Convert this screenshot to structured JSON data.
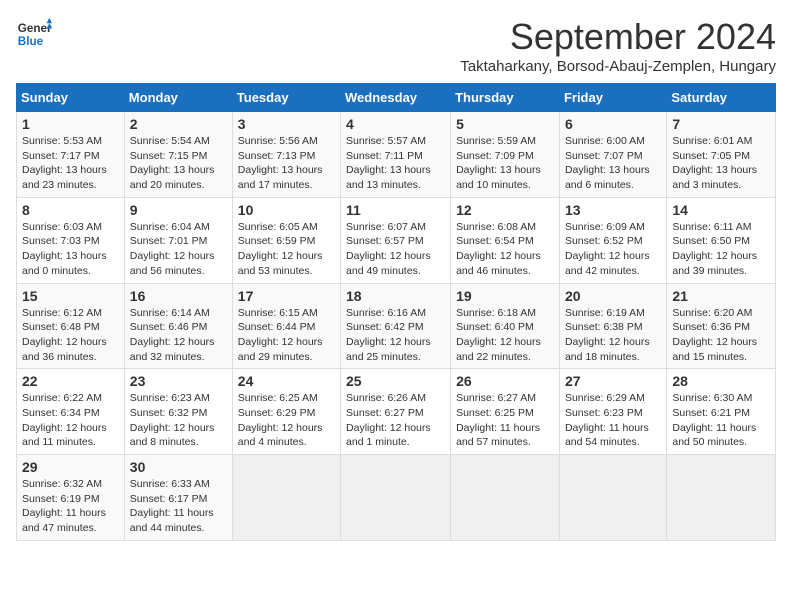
{
  "header": {
    "logo_general": "General",
    "logo_blue": "Blue",
    "month_title": "September 2024",
    "subtitle": "Taktaharkany, Borsod-Abauj-Zemplen, Hungary"
  },
  "days_of_week": [
    "Sunday",
    "Monday",
    "Tuesday",
    "Wednesday",
    "Thursday",
    "Friday",
    "Saturday"
  ],
  "weeks": [
    [
      {
        "day": "1",
        "sunrise": "5:53 AM",
        "sunset": "7:17 PM",
        "daylight": "13 hours and 23 minutes."
      },
      {
        "day": "2",
        "sunrise": "5:54 AM",
        "sunset": "7:15 PM",
        "daylight": "13 hours and 20 minutes."
      },
      {
        "day": "3",
        "sunrise": "5:56 AM",
        "sunset": "7:13 PM",
        "daylight": "13 hours and 17 minutes."
      },
      {
        "day": "4",
        "sunrise": "5:57 AM",
        "sunset": "7:11 PM",
        "daylight": "13 hours and 13 minutes."
      },
      {
        "day": "5",
        "sunrise": "5:59 AM",
        "sunset": "7:09 PM",
        "daylight": "13 hours and 10 minutes."
      },
      {
        "day": "6",
        "sunrise": "6:00 AM",
        "sunset": "7:07 PM",
        "daylight": "13 hours and 6 minutes."
      },
      {
        "day": "7",
        "sunrise": "6:01 AM",
        "sunset": "7:05 PM",
        "daylight": "13 hours and 3 minutes."
      }
    ],
    [
      {
        "day": "8",
        "sunrise": "6:03 AM",
        "sunset": "7:03 PM",
        "daylight": "13 hours and 0 minutes."
      },
      {
        "day": "9",
        "sunrise": "6:04 AM",
        "sunset": "7:01 PM",
        "daylight": "12 hours and 56 minutes."
      },
      {
        "day": "10",
        "sunrise": "6:05 AM",
        "sunset": "6:59 PM",
        "daylight": "12 hours and 53 minutes."
      },
      {
        "day": "11",
        "sunrise": "6:07 AM",
        "sunset": "6:57 PM",
        "daylight": "12 hours and 49 minutes."
      },
      {
        "day": "12",
        "sunrise": "6:08 AM",
        "sunset": "6:54 PM",
        "daylight": "12 hours and 46 minutes."
      },
      {
        "day": "13",
        "sunrise": "6:09 AM",
        "sunset": "6:52 PM",
        "daylight": "12 hours and 42 minutes."
      },
      {
        "day": "14",
        "sunrise": "6:11 AM",
        "sunset": "6:50 PM",
        "daylight": "12 hours and 39 minutes."
      }
    ],
    [
      {
        "day": "15",
        "sunrise": "6:12 AM",
        "sunset": "6:48 PM",
        "daylight": "12 hours and 36 minutes."
      },
      {
        "day": "16",
        "sunrise": "6:14 AM",
        "sunset": "6:46 PM",
        "daylight": "12 hours and 32 minutes."
      },
      {
        "day": "17",
        "sunrise": "6:15 AM",
        "sunset": "6:44 PM",
        "daylight": "12 hours and 29 minutes."
      },
      {
        "day": "18",
        "sunrise": "6:16 AM",
        "sunset": "6:42 PM",
        "daylight": "12 hours and 25 minutes."
      },
      {
        "day": "19",
        "sunrise": "6:18 AM",
        "sunset": "6:40 PM",
        "daylight": "12 hours and 22 minutes."
      },
      {
        "day": "20",
        "sunrise": "6:19 AM",
        "sunset": "6:38 PM",
        "daylight": "12 hours and 18 minutes."
      },
      {
        "day": "21",
        "sunrise": "6:20 AM",
        "sunset": "6:36 PM",
        "daylight": "12 hours and 15 minutes."
      }
    ],
    [
      {
        "day": "22",
        "sunrise": "6:22 AM",
        "sunset": "6:34 PM",
        "daylight": "12 hours and 11 minutes."
      },
      {
        "day": "23",
        "sunrise": "6:23 AM",
        "sunset": "6:32 PM",
        "daylight": "12 hours and 8 minutes."
      },
      {
        "day": "24",
        "sunrise": "6:25 AM",
        "sunset": "6:29 PM",
        "daylight": "12 hours and 4 minutes."
      },
      {
        "day": "25",
        "sunrise": "6:26 AM",
        "sunset": "6:27 PM",
        "daylight": "12 hours and 1 minute."
      },
      {
        "day": "26",
        "sunrise": "6:27 AM",
        "sunset": "6:25 PM",
        "daylight": "11 hours and 57 minutes."
      },
      {
        "day": "27",
        "sunrise": "6:29 AM",
        "sunset": "6:23 PM",
        "daylight": "11 hours and 54 minutes."
      },
      {
        "day": "28",
        "sunrise": "6:30 AM",
        "sunset": "6:21 PM",
        "daylight": "11 hours and 50 minutes."
      }
    ],
    [
      {
        "day": "29",
        "sunrise": "6:32 AM",
        "sunset": "6:19 PM",
        "daylight": "11 hours and 47 minutes."
      },
      {
        "day": "30",
        "sunrise": "6:33 AM",
        "sunset": "6:17 PM",
        "daylight": "11 hours and 44 minutes."
      },
      null,
      null,
      null,
      null,
      null
    ]
  ]
}
